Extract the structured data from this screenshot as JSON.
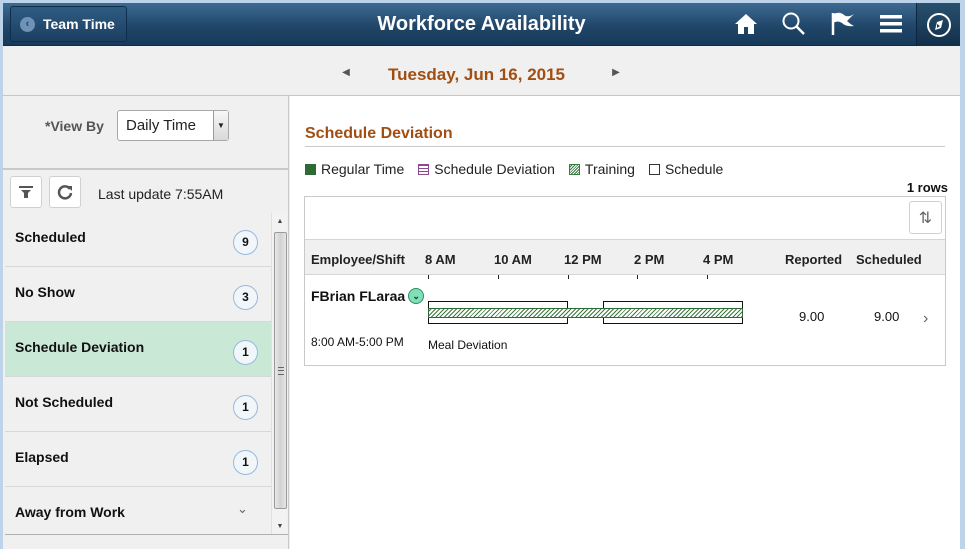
{
  "header": {
    "back_label": "Team Time",
    "title": "Workforce Availability",
    "icons": [
      "home-icon",
      "search-icon",
      "flag-icon",
      "menu-icon",
      "navbar-compass-icon"
    ]
  },
  "datebar": {
    "date": "Tuesday, Jun 16, 2015"
  },
  "left": {
    "view_by_label": "*View By",
    "view_by_value": "Daily Time",
    "last_update": "Last update 7:55AM",
    "items": [
      {
        "label": "Scheduled",
        "count": "9"
      },
      {
        "label": "No Show",
        "count": "3"
      },
      {
        "label": "Schedule Deviation",
        "count": "1",
        "selected": true
      },
      {
        "label": "Not Scheduled",
        "count": "1"
      },
      {
        "label": "Elapsed",
        "count": "1"
      },
      {
        "label": "Away from Work",
        "count": null
      }
    ]
  },
  "main": {
    "section_title": "Schedule Deviation",
    "legend": [
      {
        "label": "Regular Time",
        "color": "#2e6b34"
      },
      {
        "label": "Schedule Deviation",
        "color": "#8e4a8e"
      },
      {
        "label": "Training",
        "color": "#3b7a3f"
      },
      {
        "label": "Schedule",
        "color": "#ffffff"
      }
    ],
    "row_count": "1 rows",
    "columns": {
      "employee": "Employee/Shift",
      "times": [
        "8 AM",
        "10 AM",
        "12 PM",
        "2 PM",
        "4 PM"
      ],
      "reported": "Reported",
      "scheduled": "Scheduled"
    },
    "rows": [
      {
        "name": "FBrian FLaraa",
        "shift": "8:00 AM-5:00 PM",
        "note": "Meal Deviation",
        "reported": "9.00",
        "scheduled": "9.00",
        "schedule_blocks": [
          [
            "8:00 AM",
            "12:00 PM"
          ],
          [
            "1:00 PM",
            "5:00 PM"
          ]
        ],
        "training_block": [
          "8:00 AM",
          "5:00 PM"
        ]
      }
    ]
  },
  "colors": {
    "accent": "#a14e12",
    "header": "#1e4466",
    "selected": "#c9e8d6"
  }
}
